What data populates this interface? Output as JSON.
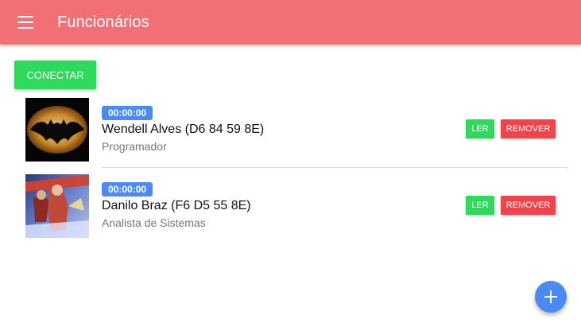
{
  "toolbar": {
    "menu_icon": "menu-icon",
    "title": "Funcionários",
    "color": "#f07075"
  },
  "connect_button": {
    "label": "CONECTAR",
    "color": "#2ed95c"
  },
  "employees": [
    {
      "timer": "00:00:00",
      "name": "Wendell Alves (D6 84 59 8E)",
      "role": "Programador",
      "read_label": "LER",
      "remove_label": "REMOVER",
      "thumbnail": "batman-logo-image"
    },
    {
      "timer": "00:00:00",
      "name": "Danilo Braz (F6 D5 55 8E)",
      "role": "Analista de Sistemas",
      "read_label": "LER",
      "remove_label": "REMOVER",
      "thumbnail": "back-to-the-future-poster-image"
    }
  ],
  "fab": {
    "icon": "plus-icon",
    "color": "#4a8af4"
  },
  "colors": {
    "badge": "#4a8af4",
    "read": "#2ed95c",
    "remove": "#f2424a"
  }
}
